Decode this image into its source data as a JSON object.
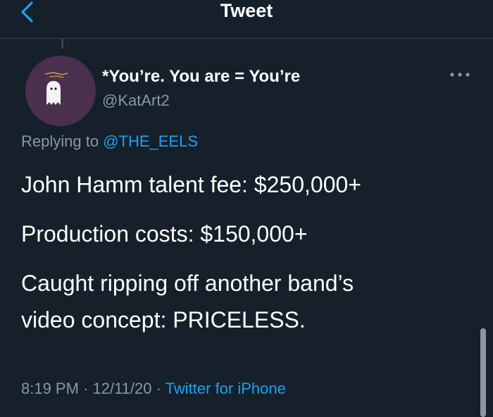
{
  "header": {
    "title": "Tweet",
    "back_icon": "chevron-left-icon"
  },
  "author": {
    "display_name": "*You’re. You are = You’re",
    "handle": "@KatArt2",
    "avatar_icon": "ghost-icon"
  },
  "more_icon": "more-horizontal-icon",
  "reply_context": {
    "prefix": "Replying to ",
    "mention": "@THE_EELS"
  },
  "tweet": {
    "lines": [
      "John Hamm talent fee: $250,000+",
      "Production costs: $150,000+",
      "Caught ripping off another band’s",
      "video concept: PRICELESS."
    ]
  },
  "meta": {
    "time": "8:19 PM",
    "separator": " · ",
    "date": "12/11/20",
    "source": "Twitter for iPhone"
  },
  "colors": {
    "background": "#15202b",
    "divider": "#38444d",
    "accent": "#1da1f2",
    "secondary_text": "#8899a6",
    "primary_text": "#ffffff"
  }
}
